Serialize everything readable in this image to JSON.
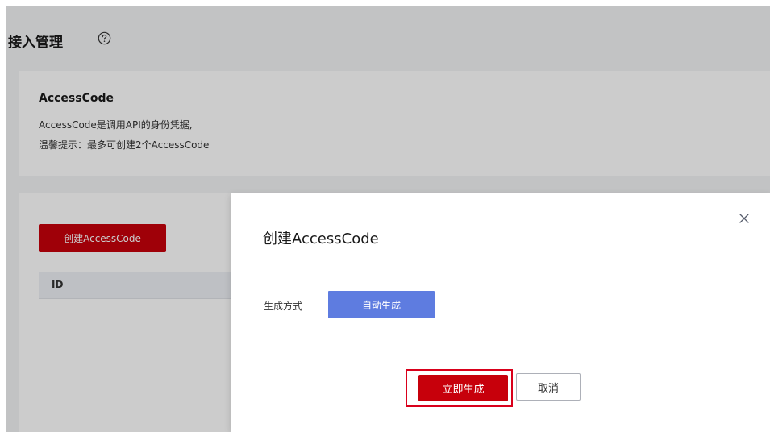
{
  "header": {
    "title": "接入管理",
    "help_icon": "question-circle-icon"
  },
  "info_card": {
    "title": "AccessCode",
    "description": "AccessCode是调用API的身份凭据,",
    "tip": "温馨提示：最多可创建2个AccessCode"
  },
  "list": {
    "create_button": "创建AccessCode",
    "columns": [
      "ID"
    ]
  },
  "dialog": {
    "title": "创建AccessCode",
    "close_icon": "close-icon",
    "generation_label": "生成方式",
    "generation_option": "自动生成",
    "confirm_button": "立即生成",
    "cancel_button": "取消"
  },
  "colors": {
    "brand_red": "#c7000b",
    "option_blue": "#5e7ce0",
    "highlight_red": "#d9001b"
  }
}
